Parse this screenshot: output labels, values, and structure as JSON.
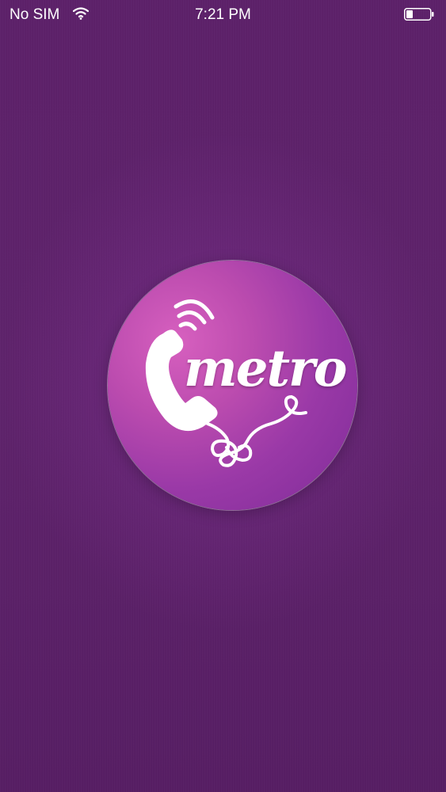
{
  "status_bar": {
    "carrier": "No SIM",
    "time": "7:21 PM"
  },
  "splash": {
    "brand_name": "metro",
    "logo_icon": "phone-handset-icon",
    "colors": {
      "background": "#5c2069",
      "logo_light": "#d760bf",
      "logo_dark": "#7e2b98",
      "foreground": "#ffffff"
    }
  }
}
